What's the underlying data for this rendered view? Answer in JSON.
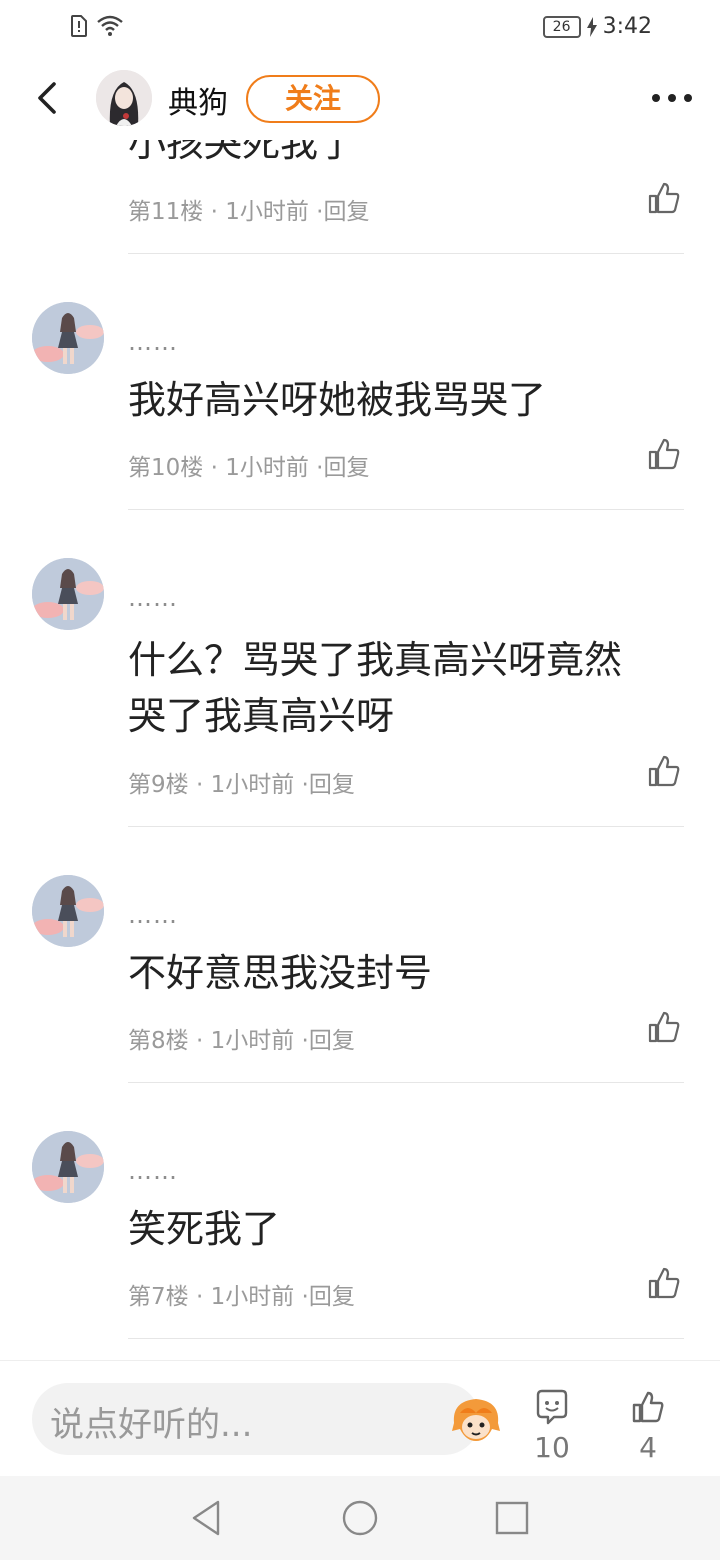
{
  "status_bar": {
    "time": "3:42",
    "battery": "26",
    "icons": [
      "sim-alert-icon",
      "wifi-icon",
      "battery-icon",
      "charging-icon"
    ]
  },
  "header": {
    "username": "典狗",
    "follow_label": "关注",
    "icons": [
      "back-arrow-icon",
      "more-icon"
    ]
  },
  "top_partial": {
    "text": "小孩哭死我了",
    "meta": "第11楼 · 1小时前 ·回复"
  },
  "comments": [
    {
      "nickname": "……",
      "text": "我好高兴呀她被我骂哭了",
      "meta": "第10楼 · 1小时前 ·回复"
    },
    {
      "nickname": "……",
      "text": "什么？骂哭了我真高兴呀竟然哭了我真高兴呀",
      "meta": "第9楼 · 1小时前 ·回复"
    },
    {
      "nickname": "……",
      "text": "不好意思我没封号",
      "meta": "第8楼 · 1小时前 ·回复"
    },
    {
      "nickname": "……",
      "text": "笑死我了",
      "meta": "第7楼 · 1小时前 ·回复"
    }
  ],
  "bottom_bar": {
    "input_placeholder": "说点好听的...",
    "comment_count": "10",
    "like_count": "4",
    "icons": [
      "emoji-icon",
      "comment-icon",
      "thumbs-up-icon"
    ]
  },
  "nav_bar": {
    "icons": [
      "back-triangle-icon",
      "home-circle-icon",
      "recents-square-icon"
    ]
  },
  "colors": {
    "accent": "#f07d1a",
    "meta_text": "#9a9a9a",
    "divider": "#e6e6e6"
  }
}
